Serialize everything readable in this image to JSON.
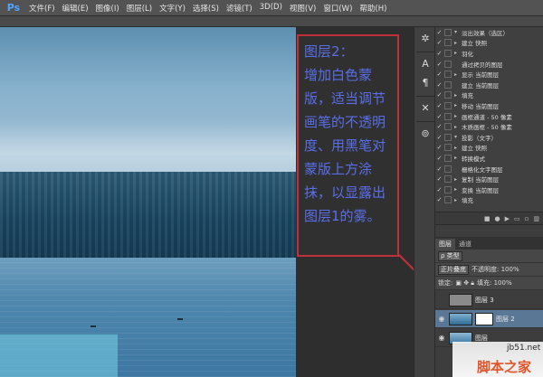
{
  "app": {
    "logo": "Ps",
    "menus": [
      "文件(F)",
      "编辑(E)",
      "图像(I)",
      "图层(L)",
      "文字(Y)",
      "选择(S)",
      "滤镜(T)",
      "3D(D)",
      "视图(V)",
      "窗口(W)",
      "帮助(H)"
    ]
  },
  "annotation": {
    "lines": [
      "图层2：",
      "增加白色蒙",
      "版，适当调节",
      "画笔的不透明",
      "度、用黑笔对",
      "蒙版上方涂",
      "抹，以显露出",
      "图层1的雾。"
    ]
  },
  "tools": [
    "✲",
    "A",
    "¶",
    "✕",
    "⊚"
  ],
  "actions": {
    "items": [
      {
        "label": "淡出效果（选区）",
        "tri": "▾"
      },
      {
        "label": "建立 快照",
        "tri": "▸"
      },
      {
        "label": "羽化",
        "tri": "▸"
      },
      {
        "label": "通过拷贝的图层",
        "tri": ""
      },
      {
        "label": "显示 当前图层",
        "tri": "▸"
      },
      {
        "label": "建立 当前图层",
        "tri": ""
      },
      {
        "label": "填充",
        "tri": "▸"
      },
      {
        "label": "移动 当前图层",
        "tri": "▸"
      },
      {
        "label": "画框通道 - 50 像素",
        "tri": "▸"
      },
      {
        "label": "木质画框 - 50 像素",
        "tri": "▸"
      },
      {
        "label": "投影（文字）",
        "tri": "▾"
      },
      {
        "label": "建立 快照",
        "tri": "▸"
      },
      {
        "label": "转换模式",
        "tri": "▸"
      },
      {
        "label": "栅格化文字图层",
        "tri": ""
      },
      {
        "label": "复制 当前图层",
        "tri": "▸"
      },
      {
        "label": "变换 当前图层",
        "tri": "▸"
      },
      {
        "label": "填充",
        "tri": "▸"
      }
    ]
  },
  "layers_panel": {
    "tabs": [
      "图层",
      "通道"
    ],
    "filter_kind": "ρ 类型",
    "blend_mode": "正片叠底",
    "opacity_label": "不透明度: 100%",
    "lock_label": "锁定:",
    "fill_label": "填充: 100%",
    "layers": [
      {
        "name": "图层 3",
        "visible": false
      },
      {
        "name": "图层 2",
        "visible": true,
        "selected": true
      },
      {
        "name": "图层",
        "visible": true
      }
    ]
  },
  "watermark": {
    "site": "jb51.net",
    "name": "脚本之家"
  }
}
